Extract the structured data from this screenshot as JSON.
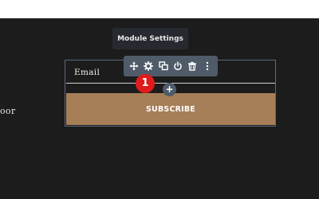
{
  "tooltip": {
    "text": "Module Settings"
  },
  "side_text": "oor",
  "form": {
    "email_label": "Email",
    "subscribe_label": "SUBSCRIBE"
  },
  "toolbar": {
    "tools": [
      "move-icon",
      "gear-icon",
      "duplicate-icon",
      "power-icon",
      "trash-icon",
      "more-vertical-icon"
    ]
  },
  "add_button": {
    "label": "+"
  },
  "step_badge": {
    "number": "1"
  },
  "colors": {
    "canvas": "#1c1c1c",
    "toolbar": "#4f5b69",
    "button": "#a67f58",
    "badge": "#e01b1b",
    "border": "#5c6b7d"
  }
}
